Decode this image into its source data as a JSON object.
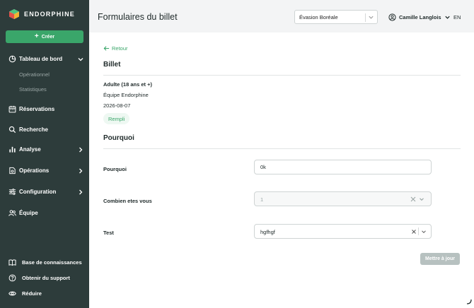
{
  "brand": {
    "name": "ENDORPHINE",
    "accent": "#3aa66a",
    "sidebar_bg": "#2d3c3b"
  },
  "sidebar": {
    "create_label": "Créer",
    "items": [
      {
        "label": "Tableau de bord",
        "icon": "pie-chart-icon",
        "expanded": true
      },
      {
        "label": "Réservations",
        "icon": "calendar-icon"
      },
      {
        "label": "Recherche",
        "icon": "search-icon"
      },
      {
        "label": "Analyse",
        "icon": "bar-chart-icon"
      },
      {
        "label": "Opérations",
        "icon": "operations-icon"
      },
      {
        "label": "Configuration",
        "icon": "sliders-icon"
      },
      {
        "label": "Équipe",
        "icon": "users-icon"
      }
    ],
    "sub_items": [
      "Opérationnel",
      "Statistiques"
    ],
    "bottom": [
      {
        "label": "Base de connaissances",
        "icon": "book-icon"
      },
      {
        "label": "Obtenir du support",
        "icon": "help-icon"
      },
      {
        "label": "Réduire",
        "icon": "eye-icon"
      }
    ]
  },
  "header": {
    "title": "Formulaires du billet",
    "org_select": "Évasion Boréale",
    "user_name": "Camille Langlois",
    "language": "EN"
  },
  "card": {
    "back_label": "Retour",
    "ticket_section": "Billet",
    "ticket_type": "Adulte (18 ans et +)",
    "team": "Équipe Endorphine",
    "date": "2026-08-07",
    "status": "Rempli",
    "form_section": "Pourquoi",
    "fields": [
      {
        "label": "Pourquoi",
        "value": "0k"
      },
      {
        "label": "Combien etes vous",
        "value": "1"
      },
      {
        "label": "Test",
        "value": "hgfhgf"
      }
    ],
    "update_label": "Mettre à jour"
  }
}
